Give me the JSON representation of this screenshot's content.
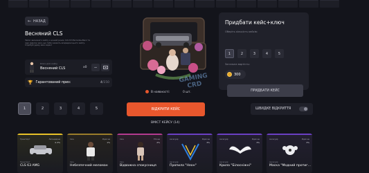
{
  "nav": {
    "back_label": "НАЗАД"
  },
  "case": {
    "title": "Весняний CLS",
    "description": "Запис весняного кейсу з цінний ринок CLS 63 Mercedes-Benz та інші рідкісні речі, що тебе чекають всередині цього кейсу. Спробуй удачу вже зараз!"
  },
  "key": {
    "label": "Ключ для кейсу",
    "name": "Весняний CLS",
    "count": "x0"
  },
  "guarantee": {
    "label": "Гарантований приз:",
    "progress": "4",
    "progress_total": "/150"
  },
  "availability": {
    "label": "В наявності:",
    "count": "0 шт."
  },
  "watermark": {
    "line1": "GAMING",
    "line2": "CRD"
  },
  "buy_panel": {
    "title": "Придбати кейс+ключ",
    "qty_label": "Оберіть кількість кейсів:",
    "qty_options": [
      "1",
      "2",
      "3",
      "4",
      "5"
    ],
    "total_label": "Загальна вартість:",
    "price": "300",
    "buy_label": "ПРИДБАТИ КЕЙС"
  },
  "open": {
    "multi_options": [
      "1",
      "2",
      "3",
      "4",
      "5"
    ],
    "open_label": "ВІДКРИТИ КЕЙС",
    "fast_label": "ШВИДКЕ ВІДКРИТТЯ",
    "contents_label": "ВМІСТ КЕЙСУ (14)"
  },
  "items": [
    {
      "category": "Транспорт",
      "rarity": "Легендарне",
      "chance": "0.3%",
      "label": "Транспорт",
      "name": "CLS 63 AMG",
      "color": "#e9c228",
      "bg": "#2a2a1f"
    },
    {
      "category": "Скін",
      "rarity": "Рідкісне",
      "chance": "1%",
      "label": "Скін",
      "name": "Небезпечний меломан",
      "color": "#9b7d2a",
      "bg": "#26231e"
    },
    {
      "category": "Скін",
      "rarity": "Епічне",
      "chance": "2%",
      "label": "Скін",
      "name": "Відважна спокусниця",
      "color": "#b43a8f",
      "bg": "#2b1f2b"
    },
    {
      "category": "Аксесуар",
      "rarity": "Рідкісне",
      "chance": "3%",
      "label": "Аксесуар",
      "name": "Пропила \"Неон\"",
      "color": "#6b3fc4",
      "bg": "#231f30"
    },
    {
      "category": "Аксесуар",
      "rarity": "Рідкісне",
      "chance": "3%",
      "label": "Аксесуар",
      "name": "Крила \"Білосніжні\"",
      "color": "#6b3fc4",
      "bg": "#231f30"
    },
    {
      "category": "Аксесуар",
      "rarity": "Рідкісне",
      "chance": "3%",
      "label": "Аксесуар",
      "name": "Маска \"Модний протиг...",
      "color": "#6b3fc4",
      "bg": "#231f30"
    }
  ]
}
